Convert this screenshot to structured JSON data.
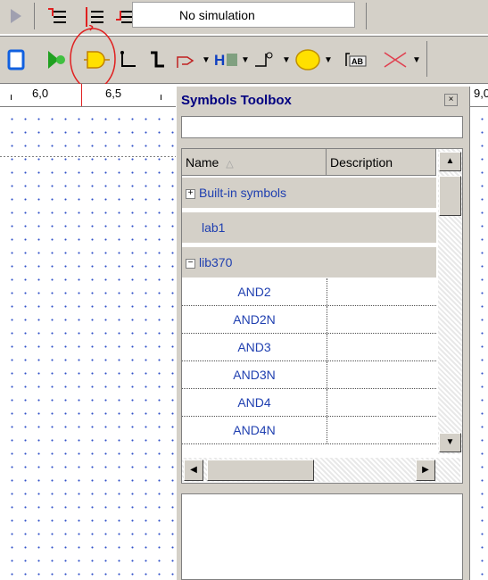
{
  "simulation": {
    "status": "No simulation"
  },
  "ruler": {
    "labels": [
      "6,0",
      "6,5",
      "9,0"
    ]
  },
  "toolbox": {
    "title": "Symbols Toolbox",
    "close_glyph": "×",
    "search_value": "",
    "columns": {
      "name": "Name",
      "description": "Description"
    },
    "groups": [
      {
        "label": "Built-in symbols",
        "expander": "+"
      },
      {
        "label": "lab1",
        "expander": ""
      },
      {
        "label": "lib370",
        "expander": "−"
      }
    ],
    "items": [
      "AND2",
      "AND2N",
      "AND3",
      "AND3N",
      "AND4",
      "AND4N"
    ]
  },
  "colors": {
    "panel_bg": "#d4d0c8",
    "link_text": "#1f3fb0",
    "title_text": "#000080",
    "highlight_circle": "#e02020",
    "canvas_dots": "#3050c8"
  },
  "icons": {
    "toolbar_top": [
      "play-arrow-icon",
      "step-in-icon",
      "align-icon",
      "step-out-icon"
    ],
    "toolbar_2": [
      "rectangle-icon",
      "green-arrow-icon",
      "gate-symbol-icon",
      "wire-icon",
      "bus-icon",
      "pin-icon",
      "hierarchy-icon",
      "ground-icon",
      "circle-icon",
      "text-label-icon",
      "delete-cross-icon"
    ]
  }
}
